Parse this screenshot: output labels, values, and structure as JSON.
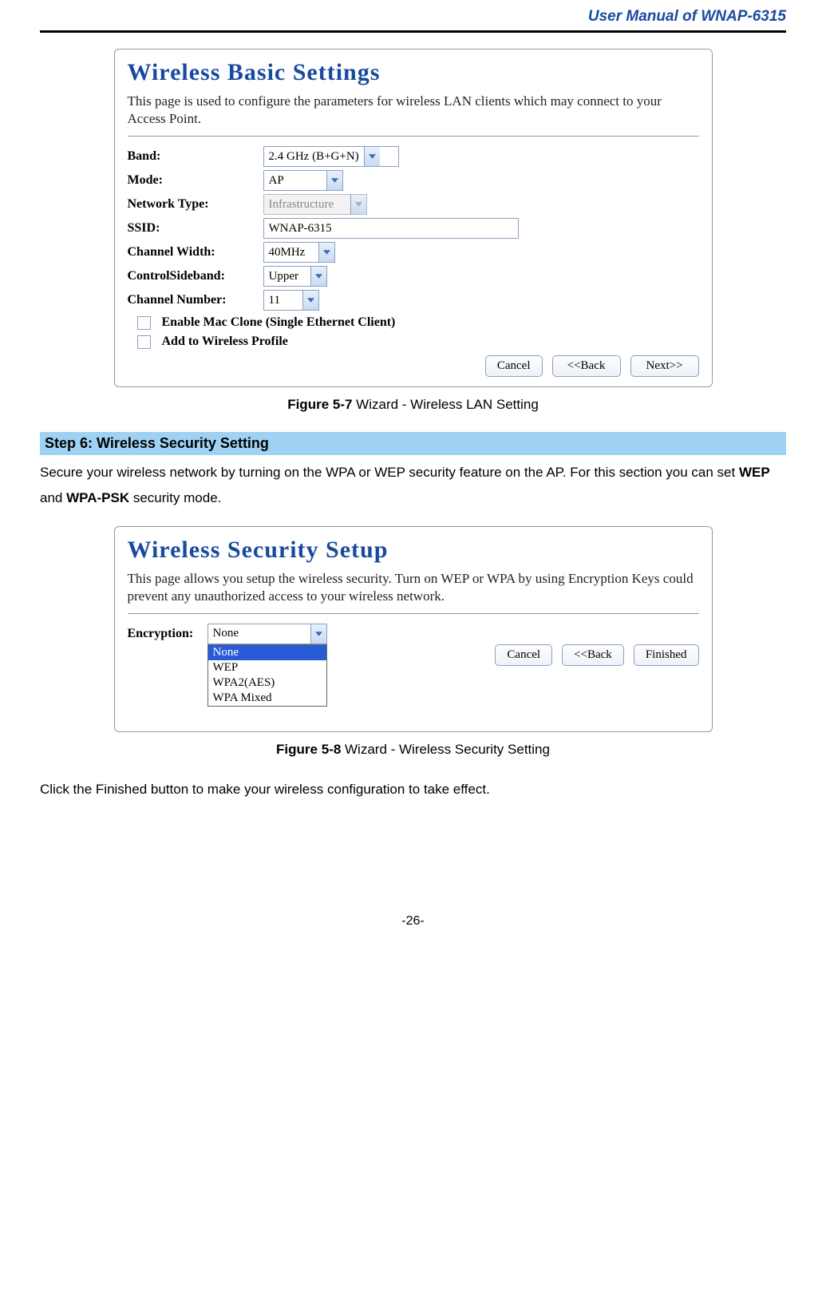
{
  "header": {
    "title": "User Manual of WNAP-6315"
  },
  "fig1": {
    "panel_title": "Wireless  Basic Settings",
    "panel_desc": "This page is used to configure the parameters for wireless LAN clients which may connect to your Access Point.",
    "rows": {
      "band": {
        "label": "Band:",
        "value": "2.4 GHz (B+G+N)"
      },
      "mode": {
        "label": "Mode:",
        "value": "AP"
      },
      "network_type": {
        "label": "Network Type:",
        "value": "Infrastructure"
      },
      "ssid": {
        "label": "SSID:",
        "value": "WNAP-6315"
      },
      "channel_width": {
        "label": "Channel Width:",
        "value": "40MHz"
      },
      "control_sideband": {
        "label": "ControlSideband:",
        "value": "Upper"
      },
      "channel_number": {
        "label": "Channel Number:",
        "value": "11"
      }
    },
    "checkboxes": {
      "mac_clone": "Enable Mac Clone (Single Ethernet Client)",
      "add_profile": "Add to Wireless Profile"
    },
    "buttons": {
      "cancel": "Cancel",
      "back": "<<Back",
      "next": "Next>>"
    },
    "caption_b": "Figure 5-7",
    "caption_t": " Wizard - Wireless LAN Setting"
  },
  "step6": {
    "bar": "Step 6: Wireless Security Setting",
    "text_a": "Secure your wireless network by turning on the WPA or WEP security feature on the AP. For this section you can set ",
    "text_b": "WEP",
    "text_c": " and ",
    "text_d": "WPA-PSK",
    "text_e": " security mode."
  },
  "fig2": {
    "panel_title": "Wireless  Security Setup",
    "panel_desc": "This page allows you setup the wireless security. Turn on WEP or WPA by using Encryption Keys could prevent any unauthorized access to your wireless network.",
    "encryption_label": "Encryption:",
    "encryption_value": "None",
    "options": [
      "None",
      "WEP",
      "WPA2(AES)",
      "WPA Mixed"
    ],
    "buttons": {
      "cancel": "Cancel",
      "back": "<<Back",
      "finished": "Finished"
    },
    "caption_b": "Figure 5-8",
    "caption_t": " Wizard - Wireless Security Setting"
  },
  "closing": "Click the Finished button to make your wireless configuration to take effect.",
  "footer": "-26-"
}
